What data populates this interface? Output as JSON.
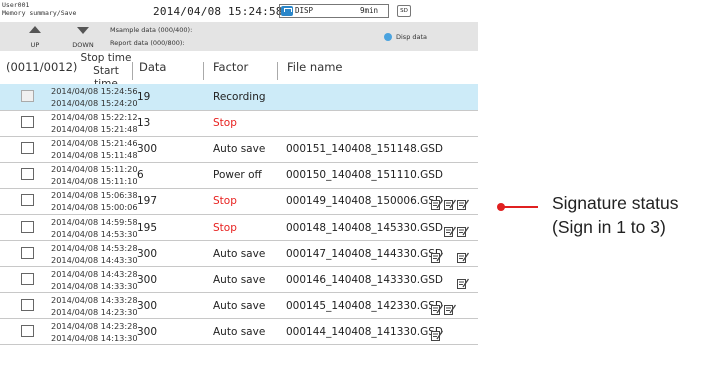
{
  "status": {
    "user": "User001",
    "breadcrumb": "Memory summary/Save",
    "datetime": "2014/04/08 15:24:58",
    "disp_label": "DISP",
    "disp_time": "9min",
    "sd_label": "SD"
  },
  "toolbar": {
    "up_label": "UP",
    "down_label": "DOWN",
    "msample": "Msample data (000/400):",
    "report": "Report data (000/800):",
    "disp_data": "Disp data"
  },
  "header": {
    "count": "(0011/0012)",
    "stop_time": "Stop time",
    "start_time": "Start time",
    "data": "Data",
    "factor": "Factor",
    "file_name": "File name"
  },
  "rows": [
    {
      "stop": "2014/04/08 15:24:56",
      "start": "2014/04/08 15:24:20",
      "data": "19",
      "factor": "Recording",
      "factor_color": "#222222",
      "file": "",
      "sign": [],
      "selected": true
    },
    {
      "stop": "2014/04/08 15:22:12",
      "start": "2014/04/08 15:21:48",
      "data": "13",
      "factor": "Stop",
      "factor_color": "#e8211f",
      "file": "",
      "sign": []
    },
    {
      "stop": "2014/04/08 15:21:46",
      "start": "2014/04/08 15:11:48",
      "data": "300",
      "factor": "Auto save",
      "factor_color": "#222222",
      "file": "000151_140408_151148.GSD",
      "sign": []
    },
    {
      "stop": "2014/04/08 15:11:20",
      "start": "2014/04/08 15:11:10",
      "data": "6",
      "factor": "Power off",
      "factor_color": "#222222",
      "file": "000150_140408_151110.GSD",
      "sign": []
    },
    {
      "stop": "2014/04/08 15:06:38",
      "start": "2014/04/08 15:00:06",
      "data": "197",
      "factor": "Stop",
      "factor_color": "#e8211f",
      "file": "000149_140408_150006.GSD",
      "sign": [
        1,
        2,
        3
      ]
    },
    {
      "stop": "2014/04/08 14:59:58",
      "start": "2014/04/08 14:53:30",
      "data": "195",
      "factor": "Stop",
      "factor_color": "#e8211f",
      "file": "000148_140408_145330.GSD",
      "sign": [
        2,
        3
      ]
    },
    {
      "stop": "2014/04/08 14:53:28",
      "start": "2014/04/08 14:43:30",
      "data": "300",
      "factor": "Auto save",
      "factor_color": "#222222",
      "file": "000147_140408_144330.GSD",
      "sign": [
        1,
        3
      ]
    },
    {
      "stop": "2014/04/08 14:43:28",
      "start": "2014/04/08 14:33:30",
      "data": "300",
      "factor": "Auto save",
      "factor_color": "#222222",
      "file": "000146_140408_143330.GSD",
      "sign": [
        3
      ]
    },
    {
      "stop": "2014/04/08 14:33:28",
      "start": "2014/04/08 14:23:30",
      "data": "300",
      "factor": "Auto save",
      "factor_color": "#222222",
      "file": "000145_140408_142330.GSD",
      "sign": [
        1,
        2
      ]
    },
    {
      "stop": "2014/04/08 14:23:28",
      "start": "2014/04/08 14:13:30",
      "data": "300",
      "factor": "Auto save",
      "factor_color": "#222222",
      "file": "000144_140408_141330.GSD",
      "sign": [
        1
      ]
    }
  ],
  "annotation": {
    "line1": "Signature status",
    "line2": "(Sign in 1 to 3)"
  }
}
